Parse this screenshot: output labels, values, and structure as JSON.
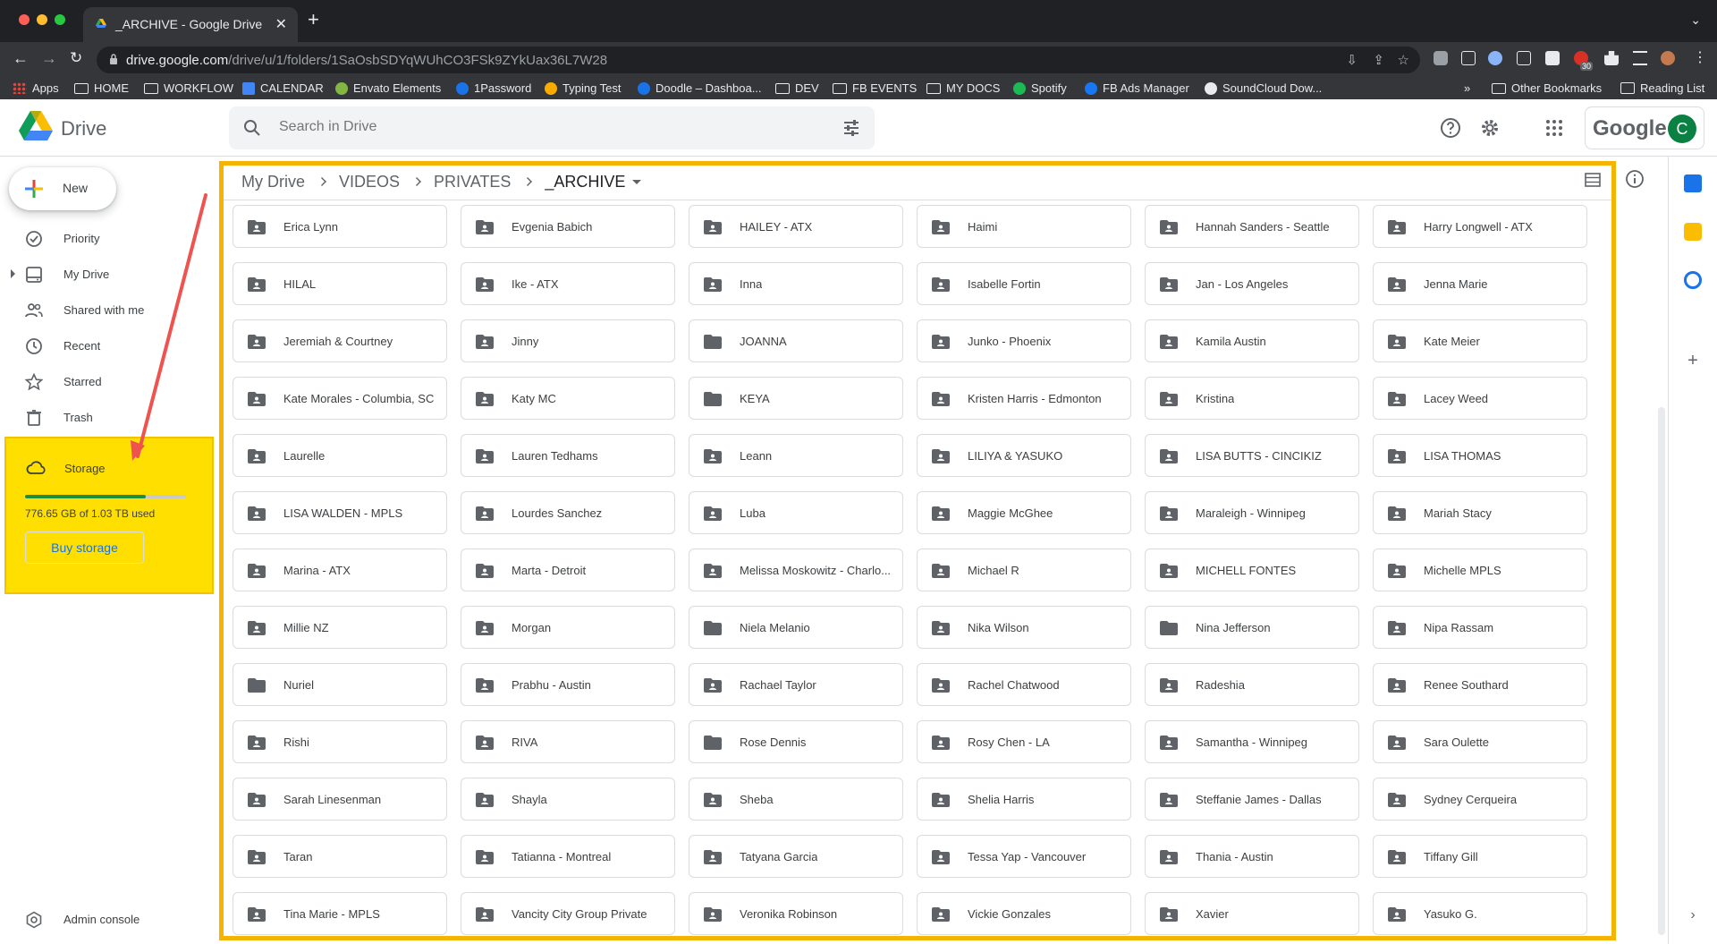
{
  "browser": {
    "tab_title": "_ARCHIVE - Google Drive",
    "url_host": "drive.google.com",
    "url_path": "/drive/u/1/folders/1SaOsbSDYqWUhCO3FSk9ZYkUax36L7W28",
    "extension_badge": "30",
    "bookmarks": [
      "Apps",
      "HOME",
      "WORKFLOW",
      "CALENDAR",
      "Envato Elements",
      "1Password",
      "Typing Test",
      "Doodle – Dashboa...",
      "DEV",
      "FB EVENTS",
      "MY DOCS",
      "Spotify",
      "FB Ads Manager",
      "SoundCloud Dow..."
    ],
    "other_bookmarks": "Other Bookmarks",
    "reading_list": "Reading List"
  },
  "header": {
    "app_name": "Drive",
    "search_placeholder": "Search in Drive",
    "google_word": "Google",
    "avatar_letter": "C"
  },
  "sidebar": {
    "new_label": "New",
    "items": [
      {
        "label": "Priority",
        "icon": "priority-icon"
      },
      {
        "label": "My Drive",
        "icon": "my-drive-icon"
      },
      {
        "label": "Shared with me",
        "icon": "shared-icon"
      },
      {
        "label": "Recent",
        "icon": "clock-icon"
      },
      {
        "label": "Starred",
        "icon": "star-icon"
      },
      {
        "label": "Trash",
        "icon": "trash-icon"
      }
    ],
    "storage": {
      "label": "Storage",
      "used_text": "776.65 GB of 1.03 TB used",
      "used_fraction": 0.75,
      "buy_label": "Buy storage"
    },
    "admin_label": "Admin console"
  },
  "breadcrumbs": [
    "My Drive",
    "VIDEOS",
    "PRIVATES",
    "_ARCHIVE"
  ],
  "folders": [
    {
      "name": "Erica Lynn",
      "shared": true
    },
    {
      "name": "Evgenia Babich",
      "shared": true
    },
    {
      "name": "HAILEY - ATX",
      "shared": true
    },
    {
      "name": "Haimi",
      "shared": true
    },
    {
      "name": "Hannah Sanders - Seattle",
      "shared": true
    },
    {
      "name": "Harry Longwell - ATX",
      "shared": true
    },
    {
      "name": "HILAL",
      "shared": true
    },
    {
      "name": "Ike - ATX",
      "shared": true
    },
    {
      "name": "Inna",
      "shared": true
    },
    {
      "name": "Isabelle Fortin",
      "shared": true
    },
    {
      "name": "Jan - Los Angeles",
      "shared": true
    },
    {
      "name": "Jenna Marie",
      "shared": true
    },
    {
      "name": "Jeremiah & Courtney",
      "shared": true
    },
    {
      "name": "Jinny",
      "shared": true
    },
    {
      "name": "JOANNA",
      "shared": false
    },
    {
      "name": "Junko - Phoenix",
      "shared": true
    },
    {
      "name": "Kamila Austin",
      "shared": true
    },
    {
      "name": "Kate Meier",
      "shared": true
    },
    {
      "name": "Kate Morales - Columbia, SC",
      "shared": true
    },
    {
      "name": "Katy MC",
      "shared": true
    },
    {
      "name": "KEYA",
      "shared": false
    },
    {
      "name": "Kristen Harris - Edmonton",
      "shared": true
    },
    {
      "name": "Kristina",
      "shared": true
    },
    {
      "name": "Lacey Weed",
      "shared": true
    },
    {
      "name": "Laurelle",
      "shared": true
    },
    {
      "name": "Lauren Tedhams",
      "shared": true
    },
    {
      "name": "Leann",
      "shared": true
    },
    {
      "name": "LILIYA & YASUKO",
      "shared": true
    },
    {
      "name": "LISA BUTTS - CINCIKIZ",
      "shared": true
    },
    {
      "name": "LISA THOMAS",
      "shared": true
    },
    {
      "name": "LISA WALDEN - MPLS",
      "shared": true
    },
    {
      "name": "Lourdes Sanchez",
      "shared": true
    },
    {
      "name": "Luba",
      "shared": true
    },
    {
      "name": "Maggie McGhee",
      "shared": true
    },
    {
      "name": "Maraleigh - Winnipeg",
      "shared": true
    },
    {
      "name": "Mariah Stacy",
      "shared": true
    },
    {
      "name": "Marina - ATX",
      "shared": true
    },
    {
      "name": "Marta - Detroit",
      "shared": true
    },
    {
      "name": "Melissa Moskowitz - Charlo...",
      "shared": true
    },
    {
      "name": "Michael R",
      "shared": true
    },
    {
      "name": "MICHELL FONTES",
      "shared": true
    },
    {
      "name": "Michelle MPLS",
      "shared": true
    },
    {
      "name": "Millie NZ",
      "shared": true
    },
    {
      "name": "Morgan",
      "shared": true
    },
    {
      "name": "Niela Melanio",
      "shared": false
    },
    {
      "name": "Nika Wilson",
      "shared": true
    },
    {
      "name": "Nina Jefferson",
      "shared": false
    },
    {
      "name": "Nipa Rassam",
      "shared": true
    },
    {
      "name": "Nuriel",
      "shared": false
    },
    {
      "name": "Prabhu - Austin",
      "shared": true
    },
    {
      "name": "Rachael Taylor",
      "shared": true
    },
    {
      "name": "Rachel Chatwood",
      "shared": true
    },
    {
      "name": "Radeshia",
      "shared": true
    },
    {
      "name": "Renee Southard",
      "shared": true
    },
    {
      "name": "Rishi",
      "shared": true
    },
    {
      "name": "RIVA",
      "shared": true
    },
    {
      "name": "Rose Dennis",
      "shared": false
    },
    {
      "name": "Rosy Chen - LA",
      "shared": true
    },
    {
      "name": "Samantha - Winnipeg",
      "shared": true
    },
    {
      "name": "Sara Oulette",
      "shared": true
    },
    {
      "name": "Sarah Linesenman",
      "shared": true
    },
    {
      "name": "Shayla",
      "shared": true
    },
    {
      "name": "Sheba",
      "shared": true
    },
    {
      "name": "Shelia Harris",
      "shared": true
    },
    {
      "name": "Steffanie James - Dallas",
      "shared": true
    },
    {
      "name": "Sydney Cerqueira",
      "shared": true
    },
    {
      "name": "Taran",
      "shared": true
    },
    {
      "name": "Tatianna - Montreal",
      "shared": true
    },
    {
      "name": "Tatyana Garcia",
      "shared": true
    },
    {
      "name": "Tessa Yap - Vancouver",
      "shared": true
    },
    {
      "name": "Thania - Austin",
      "shared": true
    },
    {
      "name": "Tiffany Gill",
      "shared": true
    },
    {
      "name": "Tina Marie - MPLS",
      "shared": true
    },
    {
      "name": "Vancity City Group Private",
      "shared": true
    },
    {
      "name": "Veronika Robinson",
      "shared": true
    },
    {
      "name": "Vickie Gonzales",
      "shared": true
    },
    {
      "name": "Xavier",
      "shared": true
    },
    {
      "name": "Yasuko G.",
      "shared": true
    }
  ],
  "colors": {
    "highlight_yellow": "#ffdf00",
    "frame_orange": "#f5b400",
    "arrow_red": "#ef5350",
    "storage_green": "#1e8e3e",
    "folder_grey": "#5f6368"
  }
}
